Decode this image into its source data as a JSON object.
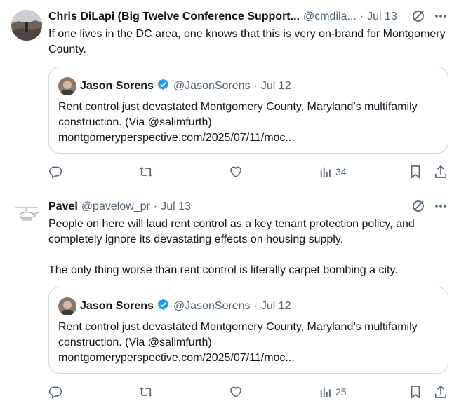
{
  "tweets": [
    {
      "author_name": "Chris DiLapi (Big Twelve Conference Support...",
      "handle": "@cmdila...",
      "separator": "·",
      "date": "Jul 13",
      "text": "If one lives in the DC area, one knows that this is very on-brand for Montgomery County.",
      "quote": {
        "author_name": "Jason Sorens",
        "handle": "@JasonSorens",
        "separator": "·",
        "date": "Jul 12",
        "text": "Rent control just devastated Montgomery County, Maryland’s multifamily construction. (Via @salimfurth)\nmontgomeryperspective.com/2025/07/11/moc..."
      },
      "views": "34"
    },
    {
      "author_name": "Pavel",
      "handle": "@pavelow_pr",
      "separator": "·",
      "date": "Jul 13",
      "text": "People on here will laud rent control as a key tenant protection policy, and completely ignore its devastating effects on housing supply.\n\nThe only thing worse than rent control is literally carpet bombing a city.",
      "quote": {
        "author_name": "Jason Sorens",
        "handle": "@JasonSorens",
        "separator": "·",
        "date": "Jul 12",
        "text": "Rent control just devastated Montgomery County, Maryland’s multifamily construction. (Via @salimfurth)\nmontgomeryperspective.com/2025/07/11/moc..."
      },
      "views": "25"
    }
  ],
  "icons": {
    "grok": "grok-icon",
    "more": "more-icon",
    "reply": "reply-icon",
    "retweet": "retweet-icon",
    "like": "like-icon",
    "views": "views-icon",
    "bookmark": "bookmark-icon",
    "share": "share-icon",
    "verified": "verified-badge-icon"
  },
  "colors": {
    "text": "#0f1419",
    "secondary": "#536471",
    "border": "#cfd9de",
    "verified": "#1d9bf0"
  }
}
